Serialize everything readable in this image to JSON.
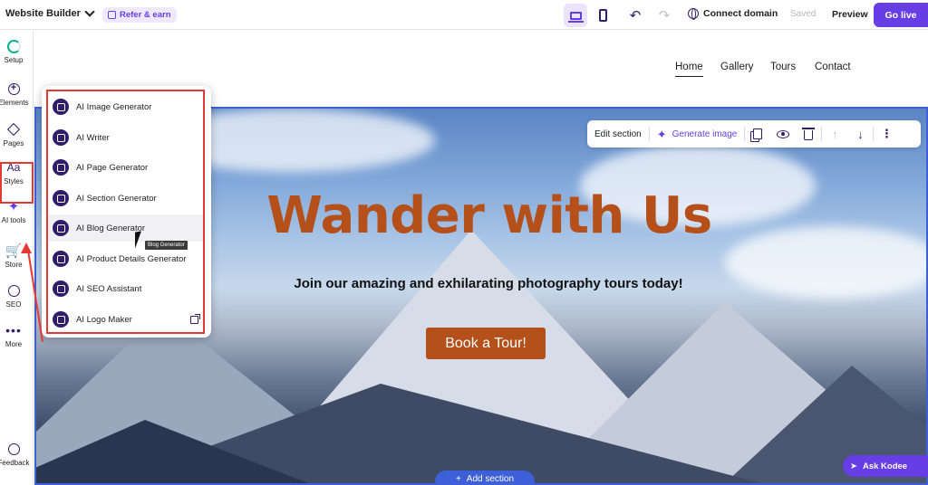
{
  "topbar": {
    "brand": "Website Builder",
    "refer": "Refer & earn",
    "connect_domain": "Connect domain",
    "saved": "Saved",
    "preview": "Preview",
    "go_live": "Go live"
  },
  "sidebar": {
    "items": [
      {
        "label": "Setup",
        "icon": "setup-progress-icon"
      },
      {
        "label": "Elements",
        "icon": "plus-circle-icon"
      },
      {
        "label": "Pages",
        "icon": "layers-icon"
      },
      {
        "label": "Styles",
        "icon": "styles-icon"
      },
      {
        "label": "AI tools",
        "icon": "sparkle-icon"
      },
      {
        "label": "Store",
        "icon": "cart-icon"
      },
      {
        "label": "SEO",
        "icon": "seo-icon"
      },
      {
        "label": "More",
        "icon": "more-icon"
      },
      {
        "label": "Feedback",
        "icon": "feedback-icon"
      }
    ]
  },
  "site": {
    "nav": [
      "Home",
      "Gallery",
      "Tours",
      "Contact"
    ],
    "hero_title": "Wander with Us",
    "hero_subtitle": "Join our amazing and exhilarating photography tours today!",
    "cta": "Book a Tour!"
  },
  "edit_bar": {
    "edit_section": "Edit section",
    "generate_image": "Generate image"
  },
  "ai_menu": {
    "items": [
      "AI Image Generator",
      "AI Writer",
      "AI Page Generator",
      "AI Section Generator",
      "AI Blog Generator",
      "AI Product Details Generator",
      "AI SEO Assistant",
      "AI Logo Maker"
    ],
    "tooltip": "Blog Generator"
  },
  "add_section": "Add section",
  "ask_kodee": "Ask Kodee",
  "colors": {
    "accent": "#673de6",
    "hero_title": "#b5501a",
    "annotation_red": "#e53935",
    "selection_blue": "#3d5fd8"
  }
}
